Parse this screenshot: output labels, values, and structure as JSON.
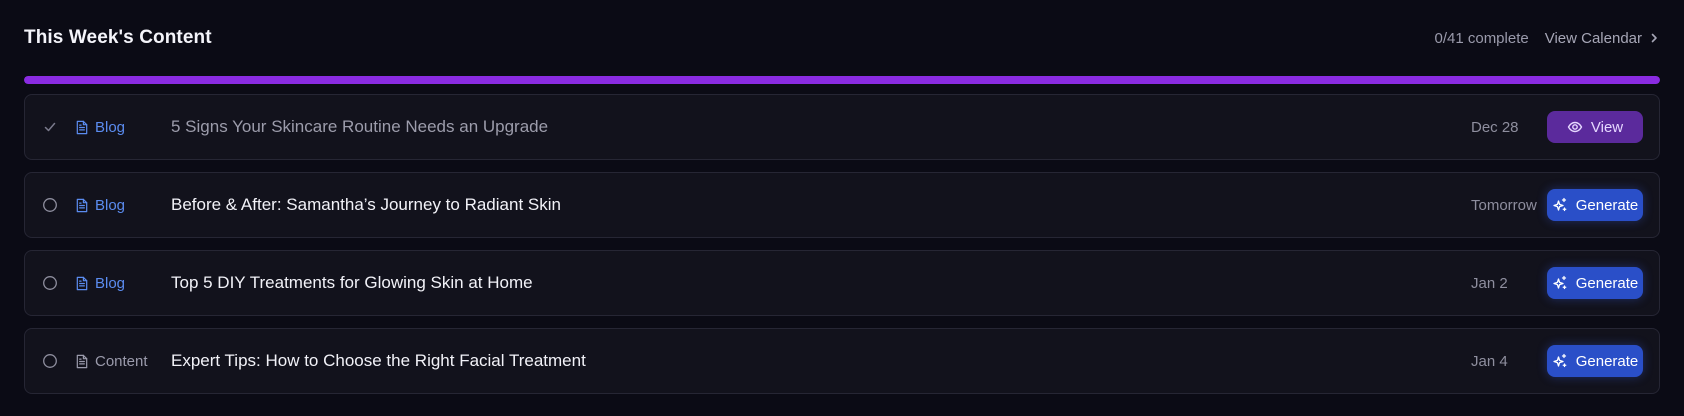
{
  "header": {
    "title": "This Week's Content",
    "progress_text": "0/41 complete",
    "view_calendar_label": "View Calendar"
  },
  "progress": {
    "fraction": 1.0
  },
  "items": [
    {
      "status": "done",
      "type": "Blog",
      "title": "5 Signs Your Skincare Routine Needs an Upgrade",
      "date": "Dec 28",
      "action": "View"
    },
    {
      "status": "pending",
      "type": "Blog",
      "title": "Before & After: Samantha’s Journey to Radiant Skin",
      "date": "Tomorrow",
      "action": "Generate"
    },
    {
      "status": "pending",
      "type": "Blog",
      "title": "Top 5 DIY Treatments for Glowing Skin at Home",
      "date": "Jan 2",
      "action": "Generate"
    },
    {
      "status": "pending",
      "type": "Content",
      "title": "Expert Tips: How to Choose the Right Facial Treatment",
      "date": "Jan 4",
      "action": "Generate"
    }
  ],
  "colors": {
    "background": "#0b0b15",
    "progress_fill": "#8a2be2",
    "blog_type": "#5b8cf0",
    "view_button": "#5b2a9c",
    "generate_button": "#2a4fc8"
  },
  "icons": {
    "done_status": "check-icon",
    "pending_status": "circle-icon",
    "type": "document-icon",
    "view": "eye-icon",
    "generate": "sparkles-icon",
    "calendar_link": "chevron-right-icon"
  }
}
